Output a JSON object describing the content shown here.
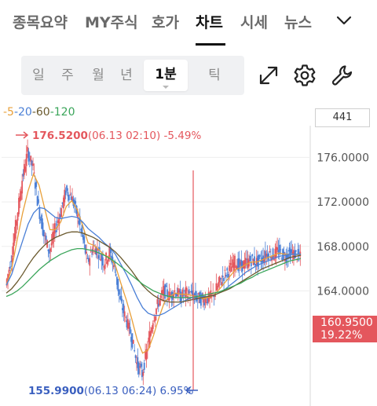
{
  "tabs": [
    {
      "label": "종목요약",
      "active": false
    },
    {
      "label": "MY주식",
      "active": false
    },
    {
      "label": "호가",
      "active": false
    },
    {
      "label": "차트",
      "active": true
    },
    {
      "label": "시세",
      "active": false
    },
    {
      "label": "뉴스",
      "active": false
    }
  ],
  "more_icon": "chevron-down-icon",
  "periods": [
    {
      "label": "일",
      "active": false
    },
    {
      "label": "주",
      "active": false
    },
    {
      "label": "월",
      "active": false
    },
    {
      "label": "년",
      "active": false
    },
    {
      "label": "1분",
      "active": true
    },
    {
      "label": "틱",
      "active": false
    }
  ],
  "tools": [
    {
      "name": "expand-icon"
    },
    {
      "name": "gear-icon"
    },
    {
      "name": "wrench-icon"
    }
  ],
  "ma_legend": {
    "sep": "-",
    "items": [
      {
        "label": "5",
        "color": "#e8a03a"
      },
      {
        "label": "20",
        "color": "#4a7fd6"
      },
      {
        "label": "60",
        "color": "#6b5a2e"
      },
      {
        "label": "120",
        "color": "#3aa55a"
      }
    ]
  },
  "volume_box": "441",
  "colors": {
    "up": "#e4575d",
    "down": "#4a7fd6",
    "grid": "#eeeeee",
    "high_label": "#e4575d",
    "low_label": "#3a5fbf"
  },
  "chart_data": {
    "type": "line",
    "y_ticks": [
      "176.0000",
      "172.0000",
      "168.0000",
      "164.0000"
    ],
    "ylim": [
      154.5,
      178.5
    ],
    "high": {
      "value": "176.5200",
      "time": "(06.13 02:10)",
      "pct": "-5.49%",
      "price": 176.52
    },
    "low": {
      "value": "155.9900",
      "time": "(06.13 06:24)",
      "pct": "6.95%",
      "price": 155.99
    },
    "current": {
      "value": "160.9500",
      "pct": "19.22%"
    },
    "series": [
      {
        "label": "close",
        "color": "#e4575d",
        "values": [
          164.5,
          167,
          170.5,
          174,
          176.5,
          175,
          171.5,
          169,
          167.5,
          169.5,
          171,
          173,
          172.5,
          171,
          169,
          166.5,
          168,
          167.5,
          166.5,
          167.5,
          166,
          163,
          161.5,
          160,
          157.5,
          156.5,
          159,
          161.5,
          163,
          164,
          163.5,
          164,
          163.5,
          163.8,
          163.6,
          163.4,
          163.2,
          163.3,
          163.6,
          164.6,
          165.4,
          165.9,
          166.6,
          166.2,
          166.5,
          166.8,
          166.6,
          166.9,
          167.4,
          167.2,
          167.6,
          167.1,
          167.4,
          167.3,
          167.0
        ]
      },
      {
        "label": "5",
        "color": "#e8a03a",
        "values": [
          164.5,
          166,
          168.6,
          171,
          173,
          174.5,
          173.5,
          171.5,
          169.5,
          169.5,
          170.2,
          171.6,
          172.1,
          171.3,
          169.9,
          168.3,
          168.1,
          167.7,
          167.2,
          167.0,
          166.3,
          164.7,
          163.2,
          161.5,
          159.6,
          158.4,
          158.7,
          160.0,
          161.6,
          163.0,
          163.5,
          163.8,
          163.7,
          163.7,
          163.6,
          163.5,
          163.3,
          163.4,
          163.6,
          164.1,
          164.7,
          165.3,
          165.9,
          166.1,
          166.4,
          166.6,
          166.6,
          166.8,
          167.0,
          167.2,
          167.4,
          167.3,
          167.3,
          167.3,
          167.2
        ]
      },
      {
        "label": "20",
        "color": "#4a7fd6",
        "values": [
          164.5,
          165.5,
          167.0,
          168.5,
          170.0,
          171.0,
          171.5,
          171.4,
          171.0,
          170.6,
          170.5,
          170.6,
          170.7,
          170.6,
          170.2,
          169.6,
          169.2,
          168.8,
          168.3,
          167.9,
          167.3,
          166.4,
          165.5,
          164.5,
          163.4,
          162.5,
          162.0,
          161.8,
          161.8,
          162.0,
          162.3,
          162.6,
          162.9,
          163.2,
          163.4,
          163.5,
          163.5,
          163.5,
          163.6,
          163.8,
          164.1,
          164.5,
          164.9,
          165.3,
          165.7,
          166.0,
          166.3,
          166.5,
          166.7,
          166.9,
          167.1,
          167.2,
          167.3,
          167.3,
          167.3
        ]
      },
      {
        "label": "60",
        "color": "#6b5a2e",
        "values": [
          163.8,
          164.2,
          164.8,
          165.5,
          166.3,
          167.0,
          167.6,
          168.1,
          168.5,
          168.8,
          169.0,
          169.2,
          169.3,
          169.3,
          169.2,
          169.0,
          168.8,
          168.5,
          168.2,
          167.9,
          167.5,
          167.0,
          166.4,
          165.8,
          165.1,
          164.5,
          164.0,
          163.6,
          163.3,
          163.1,
          163.0,
          163.0,
          163.0,
          163.1,
          163.2,
          163.3,
          163.4,
          163.5,
          163.6,
          163.8,
          164.0,
          164.2,
          164.5,
          164.8,
          165.1,
          165.4,
          165.7,
          166.0,
          166.2,
          166.4,
          166.6,
          166.8,
          167.0,
          167.1,
          167.2
        ]
      },
      {
        "label": "120",
        "color": "#3aa55a",
        "values": [
          163.5,
          163.7,
          164.0,
          164.4,
          164.9,
          165.4,
          165.9,
          166.3,
          166.7,
          167.0,
          167.3,
          167.5,
          167.7,
          167.8,
          167.8,
          167.7,
          167.6,
          167.4,
          167.2,
          166.9,
          166.6,
          166.2,
          165.8,
          165.4,
          165.0,
          164.6,
          164.3,
          164.0,
          163.8,
          163.6,
          163.5,
          163.4,
          163.4,
          163.4,
          163.4,
          163.5,
          163.6,
          163.7,
          163.8,
          163.9,
          164.1,
          164.3,
          164.5,
          164.7,
          165.0,
          165.2,
          165.5,
          165.7,
          165.9,
          166.1,
          166.3,
          166.5,
          166.7,
          166.8,
          166.9
        ]
      }
    ]
  }
}
